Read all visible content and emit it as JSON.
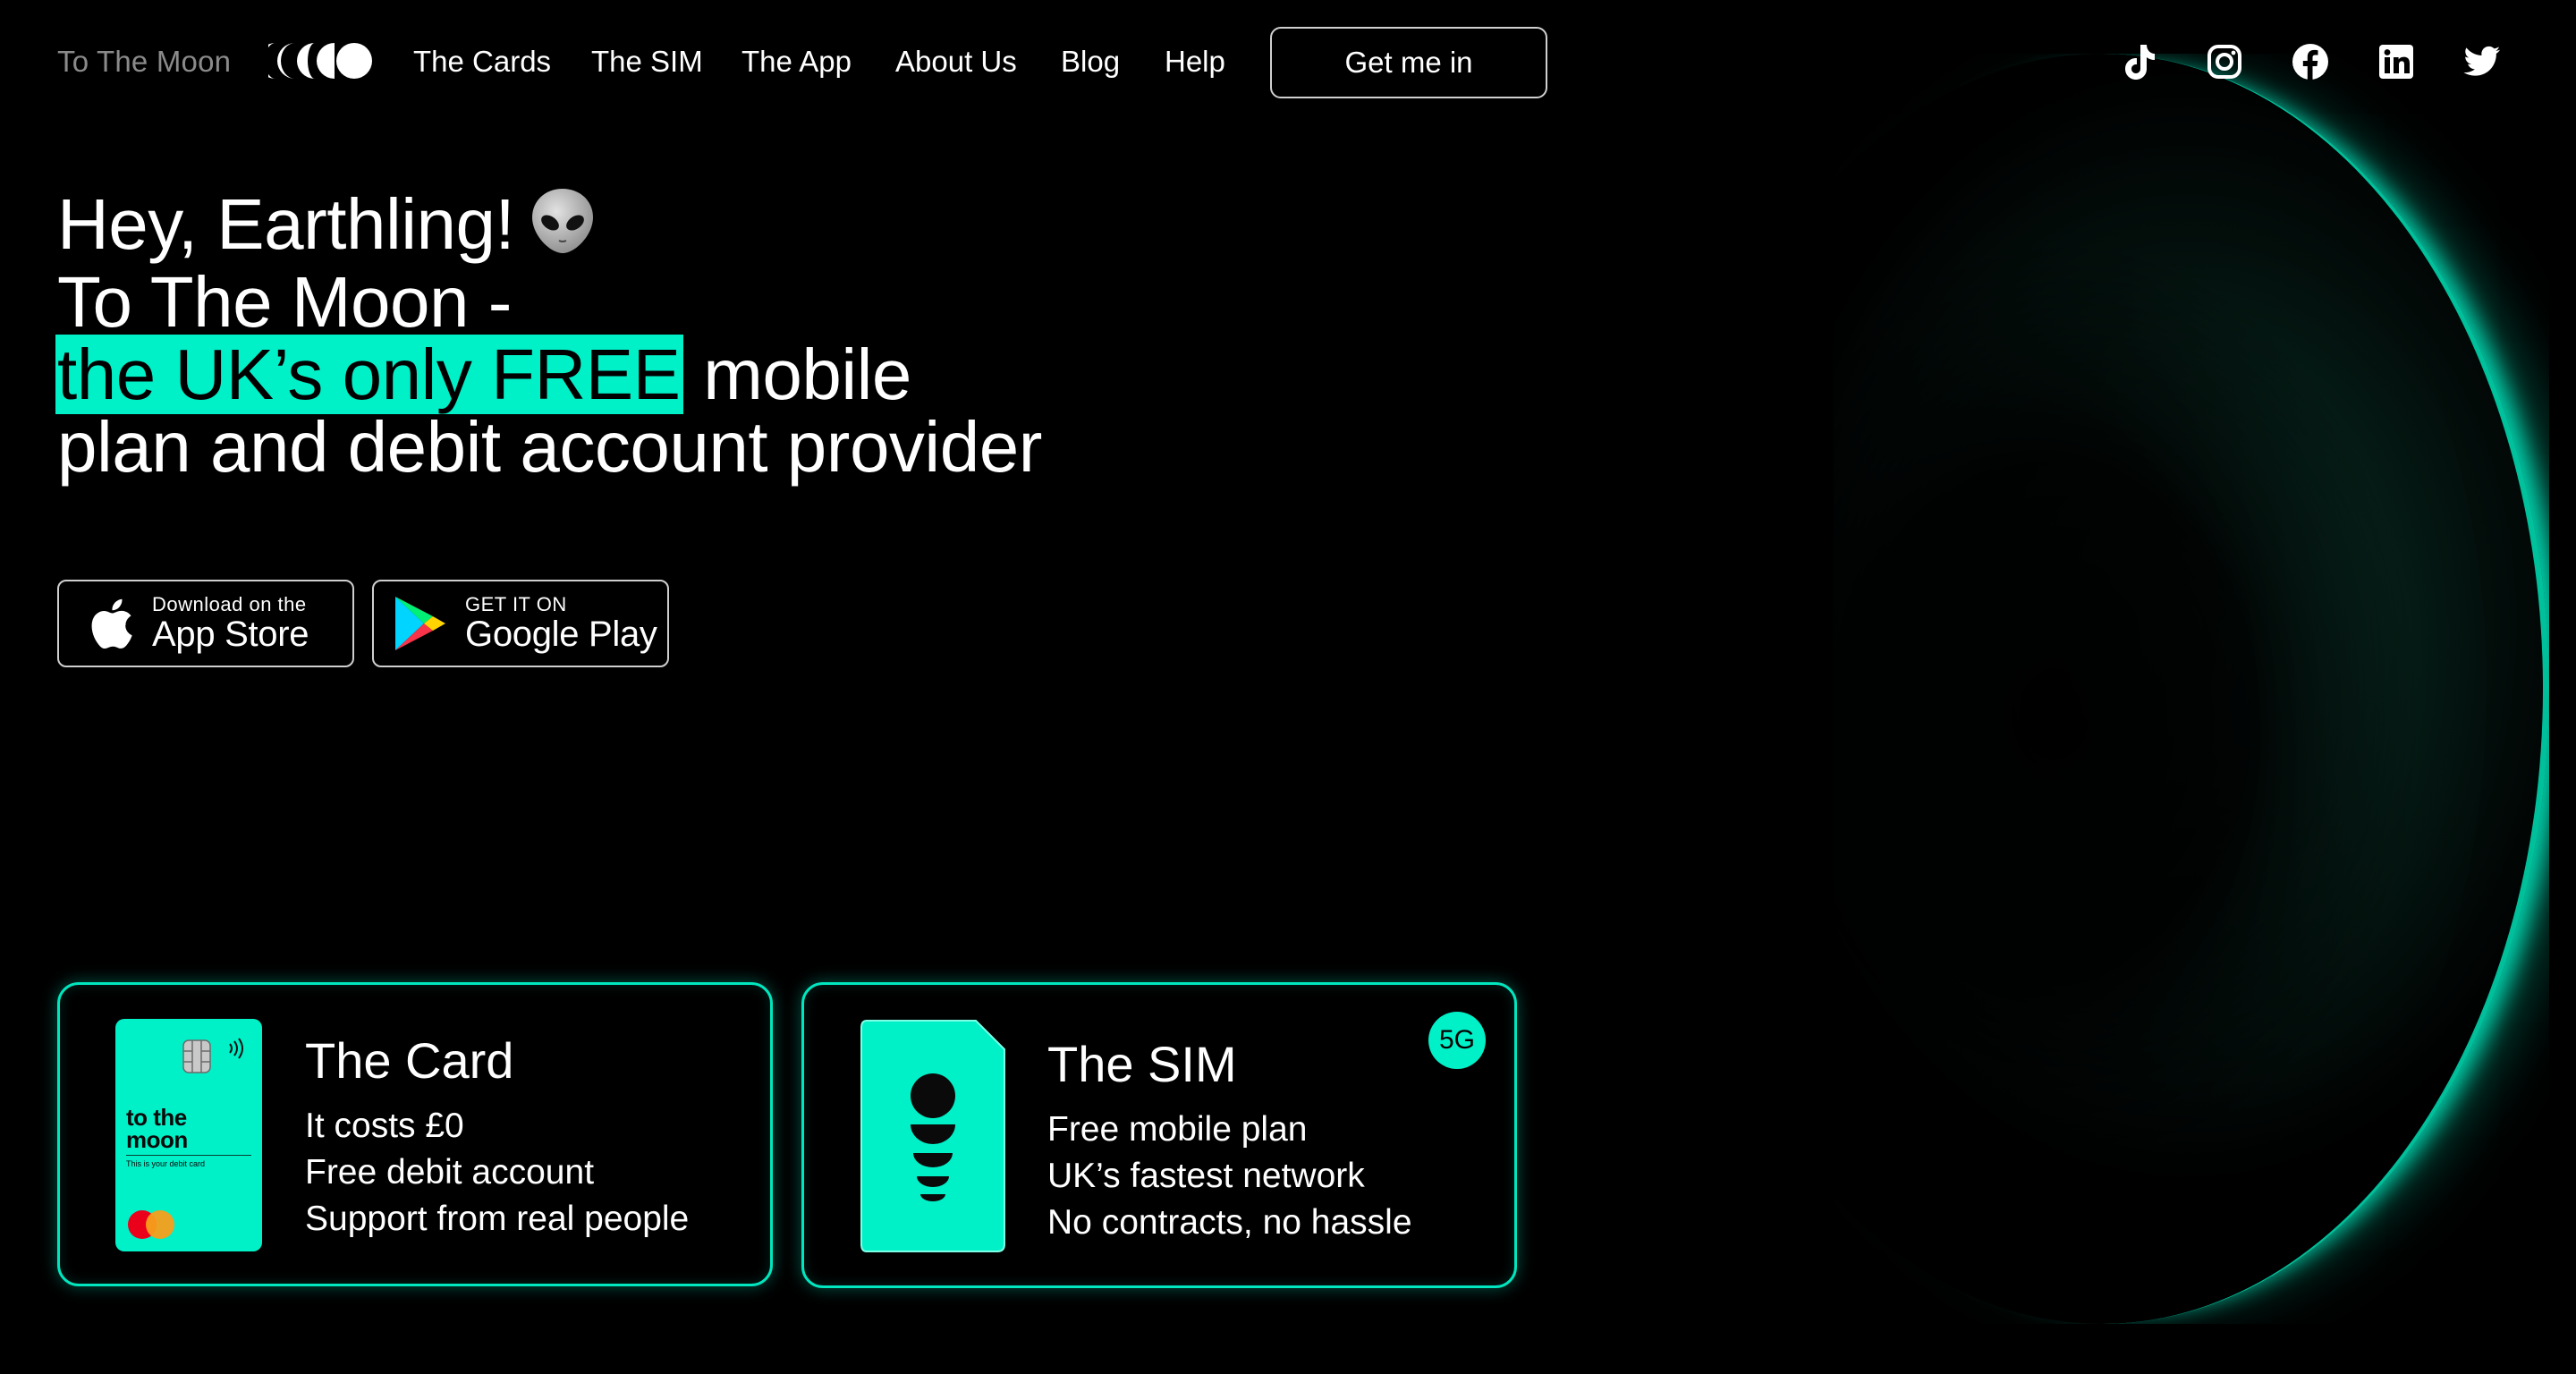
{
  "nav": {
    "brand": "To The Moon",
    "links": [
      "The Cards",
      "The SIM",
      "The App",
      "About Us",
      "Blog",
      "Help"
    ],
    "cta": "Get me in",
    "social_icons": [
      "tiktok-icon",
      "instagram-icon",
      "facebook-icon",
      "linkedin-icon",
      "twitter-icon"
    ]
  },
  "hero": {
    "line1": "Hey, Earthling!",
    "line2": "To The Moon -",
    "line3_highlight": "the UK’s only FREE",
    "line3_rest": "mobile",
    "line4": "plan and debit account provider",
    "emoji_icon": "alien-icon"
  },
  "badges": {
    "appstore": {
      "small": "Download on the",
      "big": "App Store"
    },
    "googleplay": {
      "small": "GET IT ON",
      "big": "Google Play"
    }
  },
  "features": {
    "card": {
      "title": "The Card",
      "lines": [
        "It costs £0",
        "Free debit account",
        "Support from real people"
      ],
      "card_brand_line1": "to the",
      "card_brand_line2": "moon",
      "card_caption": "This is your debit card"
    },
    "sim": {
      "title": "The SIM",
      "lines": [
        "Free mobile plan",
        "UK’s fastest network",
        "No contracts, no hassle"
      ],
      "badge": "5G"
    }
  },
  "colors": {
    "accent": "#00f0c8",
    "background": "#000000",
    "text": "#ffffff",
    "brand_muted": "#8a8a8a"
  }
}
